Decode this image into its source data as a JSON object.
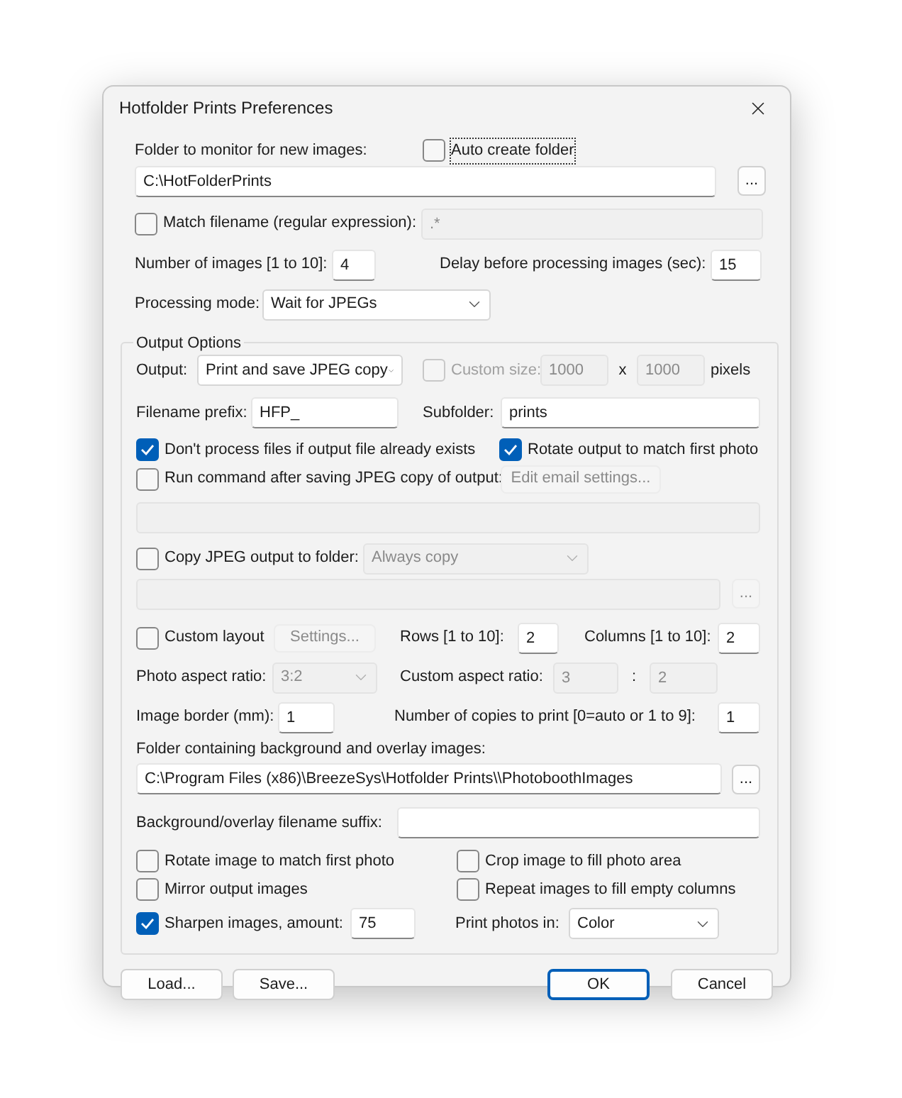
{
  "window": {
    "title": "Hotfolder Prints Preferences"
  },
  "monitor": {
    "label": "Folder to monitor for new images:",
    "auto_create": {
      "label": "Auto create folder",
      "checked": false,
      "focused": true
    },
    "path": {
      "value": "C:\\HotFolderPrints",
      "disabled": false
    },
    "browse": {
      "label": "...",
      "disabled": false
    }
  },
  "match_filename": {
    "checkbox": {
      "label": "Match filename (regular expression):",
      "checked": false
    },
    "pattern": {
      "value": ".*",
      "disabled": true
    }
  },
  "number_of_images": {
    "label": "Number of images [1 to 10]:",
    "field": {
      "value": "4",
      "disabled": false
    }
  },
  "delay": {
    "label": "Delay before processing images (sec):",
    "field": {
      "value": "15",
      "disabled": false
    }
  },
  "processing_mode": {
    "label": "Processing mode:",
    "combo": {
      "value": "Wait for JPEGs",
      "disabled": false
    }
  },
  "output_options": {
    "title": "Output Options",
    "output": {
      "label": "Output:",
      "combo": {
        "value": "Print and save JPEG copy",
        "disabled": false
      }
    },
    "custom_size": {
      "checkbox": {
        "label": "Custom size:",
        "checked": false,
        "disabled": true
      },
      "width": {
        "value": "1000",
        "disabled": true
      },
      "separator": "x",
      "height": {
        "value": "1000",
        "disabled": true
      },
      "unit": "pixels"
    },
    "filename_prefix": {
      "label": "Filename prefix:",
      "field": {
        "value": "HFP_",
        "disabled": false
      }
    },
    "subfolder": {
      "label": "Subfolder:",
      "field": {
        "value": "prints",
        "disabled": false
      }
    },
    "dont_process": {
      "label": "Don't process files if output file already exists",
      "checked": true
    },
    "rotate_output": {
      "label": "Rotate output to match first photo",
      "checked": true
    },
    "run_command": {
      "checkbox": {
        "label": "Run command after saving JPEG copy of output:",
        "checked": false
      },
      "email_button": {
        "label": "Edit email settings...",
        "disabled": true
      },
      "command": {
        "disabled": true
      }
    },
    "copy_output": {
      "checkbox": {
        "label": "Copy JPEG output to folder:",
        "checked": false
      },
      "mode": {
        "value": "Always copy",
        "disabled": true
      },
      "folder": {
        "disabled": true
      },
      "browse": {
        "label": "...",
        "disabled": true
      }
    },
    "custom_layout": {
      "checkbox": {
        "label": "Custom layout",
        "checked": false
      },
      "settings": {
        "label": "Settings...",
        "disabled": true
      }
    },
    "rows": {
      "label": "Rows [1 to 10]:",
      "field": {
        "value": "2",
        "disabled": false
      }
    },
    "columns": {
      "label": "Columns [1 to 10]:",
      "field": {
        "value": "2",
        "disabled": false
      }
    },
    "photo_aspect": {
      "label": "Photo aspect ratio:",
      "combo": {
        "value": "3:2",
        "disabled": true
      }
    },
    "custom_aspect": {
      "label": "Custom aspect ratio:",
      "a": {
        "value": "3",
        "disabled": true
      },
      "separator": ":",
      "b": {
        "value": "2",
        "disabled": true
      }
    },
    "image_border": {
      "label": "Image border (mm):",
      "field": {
        "value": "1",
        "disabled": false
      }
    },
    "copies": {
      "label": "Number of copies to print [0=auto or 1 to 9]:",
      "field": {
        "value": "1",
        "disabled": false
      }
    },
    "background_folder": {
      "label": "Folder containing background and overlay images:",
      "path": {
        "value": "C:\\Program Files (x86)\\BreezeSys\\Hotfolder Prints\\\\PhotoboothImages",
        "disabled": false
      },
      "browse": {
        "label": "...",
        "disabled": false
      }
    },
    "suffix": {
      "label": "Background/overlay filename suffix:",
      "field": {
        "disabled": false
      }
    },
    "options": [
      {
        "label": "Rotate image to match first photo",
        "checked": false
      },
      {
        "label": "Crop image to fill photo area",
        "checked": false
      },
      {
        "label": "Mirror output images",
        "checked": false
      },
      {
        "label": "Repeat images to fill empty columns",
        "checked": false
      }
    ],
    "sharpen": {
      "checkbox": {
        "label": "Sharpen images, amount:",
        "checked": true
      },
      "amount": {
        "value": "75",
        "disabled": false
      }
    },
    "print_in": {
      "label": "Print photos in:",
      "combo": {
        "value": "Color",
        "disabled": false
      }
    }
  },
  "buttons": [
    {
      "label": "Load...",
      "default": false
    },
    {
      "label": "Save...",
      "default": false
    },
    {
      "label": "OK",
      "default": true
    },
    {
      "label": "Cancel",
      "default": false
    }
  ]
}
